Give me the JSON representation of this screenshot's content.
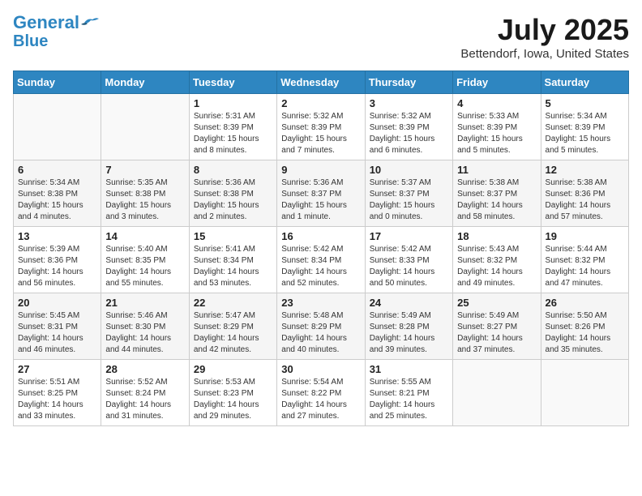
{
  "header": {
    "logo_line1": "General",
    "logo_line2": "Blue",
    "month": "July 2025",
    "location": "Bettendorf, Iowa, United States"
  },
  "weekdays": [
    "Sunday",
    "Monday",
    "Tuesday",
    "Wednesday",
    "Thursday",
    "Friday",
    "Saturday"
  ],
  "weeks": [
    [
      {
        "day": "",
        "info": ""
      },
      {
        "day": "",
        "info": ""
      },
      {
        "day": "1",
        "info": "Sunrise: 5:31 AM\nSunset: 8:39 PM\nDaylight: 15 hours\nand 8 minutes."
      },
      {
        "day": "2",
        "info": "Sunrise: 5:32 AM\nSunset: 8:39 PM\nDaylight: 15 hours\nand 7 minutes."
      },
      {
        "day": "3",
        "info": "Sunrise: 5:32 AM\nSunset: 8:39 PM\nDaylight: 15 hours\nand 6 minutes."
      },
      {
        "day": "4",
        "info": "Sunrise: 5:33 AM\nSunset: 8:39 PM\nDaylight: 15 hours\nand 5 minutes."
      },
      {
        "day": "5",
        "info": "Sunrise: 5:34 AM\nSunset: 8:39 PM\nDaylight: 15 hours\nand 5 minutes."
      }
    ],
    [
      {
        "day": "6",
        "info": "Sunrise: 5:34 AM\nSunset: 8:38 PM\nDaylight: 15 hours\nand 4 minutes."
      },
      {
        "day": "7",
        "info": "Sunrise: 5:35 AM\nSunset: 8:38 PM\nDaylight: 15 hours\nand 3 minutes."
      },
      {
        "day": "8",
        "info": "Sunrise: 5:36 AM\nSunset: 8:38 PM\nDaylight: 15 hours\nand 2 minutes."
      },
      {
        "day": "9",
        "info": "Sunrise: 5:36 AM\nSunset: 8:37 PM\nDaylight: 15 hours\nand 1 minute."
      },
      {
        "day": "10",
        "info": "Sunrise: 5:37 AM\nSunset: 8:37 PM\nDaylight: 15 hours\nand 0 minutes."
      },
      {
        "day": "11",
        "info": "Sunrise: 5:38 AM\nSunset: 8:37 PM\nDaylight: 14 hours\nand 58 minutes."
      },
      {
        "day": "12",
        "info": "Sunrise: 5:38 AM\nSunset: 8:36 PM\nDaylight: 14 hours\nand 57 minutes."
      }
    ],
    [
      {
        "day": "13",
        "info": "Sunrise: 5:39 AM\nSunset: 8:36 PM\nDaylight: 14 hours\nand 56 minutes."
      },
      {
        "day": "14",
        "info": "Sunrise: 5:40 AM\nSunset: 8:35 PM\nDaylight: 14 hours\nand 55 minutes."
      },
      {
        "day": "15",
        "info": "Sunrise: 5:41 AM\nSunset: 8:34 PM\nDaylight: 14 hours\nand 53 minutes."
      },
      {
        "day": "16",
        "info": "Sunrise: 5:42 AM\nSunset: 8:34 PM\nDaylight: 14 hours\nand 52 minutes."
      },
      {
        "day": "17",
        "info": "Sunrise: 5:42 AM\nSunset: 8:33 PM\nDaylight: 14 hours\nand 50 minutes."
      },
      {
        "day": "18",
        "info": "Sunrise: 5:43 AM\nSunset: 8:32 PM\nDaylight: 14 hours\nand 49 minutes."
      },
      {
        "day": "19",
        "info": "Sunrise: 5:44 AM\nSunset: 8:32 PM\nDaylight: 14 hours\nand 47 minutes."
      }
    ],
    [
      {
        "day": "20",
        "info": "Sunrise: 5:45 AM\nSunset: 8:31 PM\nDaylight: 14 hours\nand 46 minutes."
      },
      {
        "day": "21",
        "info": "Sunrise: 5:46 AM\nSunset: 8:30 PM\nDaylight: 14 hours\nand 44 minutes."
      },
      {
        "day": "22",
        "info": "Sunrise: 5:47 AM\nSunset: 8:29 PM\nDaylight: 14 hours\nand 42 minutes."
      },
      {
        "day": "23",
        "info": "Sunrise: 5:48 AM\nSunset: 8:29 PM\nDaylight: 14 hours\nand 40 minutes."
      },
      {
        "day": "24",
        "info": "Sunrise: 5:49 AM\nSunset: 8:28 PM\nDaylight: 14 hours\nand 39 minutes."
      },
      {
        "day": "25",
        "info": "Sunrise: 5:49 AM\nSunset: 8:27 PM\nDaylight: 14 hours\nand 37 minutes."
      },
      {
        "day": "26",
        "info": "Sunrise: 5:50 AM\nSunset: 8:26 PM\nDaylight: 14 hours\nand 35 minutes."
      }
    ],
    [
      {
        "day": "27",
        "info": "Sunrise: 5:51 AM\nSunset: 8:25 PM\nDaylight: 14 hours\nand 33 minutes."
      },
      {
        "day": "28",
        "info": "Sunrise: 5:52 AM\nSunset: 8:24 PM\nDaylight: 14 hours\nand 31 minutes."
      },
      {
        "day": "29",
        "info": "Sunrise: 5:53 AM\nSunset: 8:23 PM\nDaylight: 14 hours\nand 29 minutes."
      },
      {
        "day": "30",
        "info": "Sunrise: 5:54 AM\nSunset: 8:22 PM\nDaylight: 14 hours\nand 27 minutes."
      },
      {
        "day": "31",
        "info": "Sunrise: 5:55 AM\nSunset: 8:21 PM\nDaylight: 14 hours\nand 25 minutes."
      },
      {
        "day": "",
        "info": ""
      },
      {
        "day": "",
        "info": ""
      }
    ]
  ]
}
